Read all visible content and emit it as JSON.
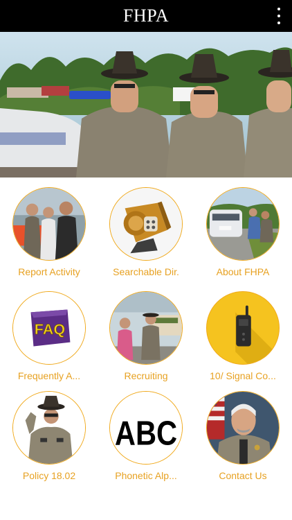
{
  "app": {
    "title": "FHPA",
    "menu_icon": "more-vert-icon"
  },
  "hero": {
    "image": "troopers-banner-photo"
  },
  "colors": {
    "appbar_bg": "#000000",
    "accent": "#e7a121",
    "tile_border": "#f0a818"
  },
  "menu": {
    "items": [
      {
        "label": "Report Activity",
        "icon": "officers-at-event-photo"
      },
      {
        "label": "Searchable Dir.",
        "icon": "directory-device-icon"
      },
      {
        "label": "About FHPA",
        "icon": "traffic-stop-photo"
      },
      {
        "label": "Frequently A...",
        "icon": "faq-icon"
      },
      {
        "label": "Recruiting",
        "icon": "recruiting-booth-photo"
      },
      {
        "label": "10/ Signal Co...",
        "icon": "radio-icon"
      },
      {
        "label": "Policy 18.02",
        "icon": "saluting-trooper-photo"
      },
      {
        "label": "Phonetic Alp...",
        "icon": "abc-icon"
      },
      {
        "label": "Contact Us",
        "icon": "officer-portrait-photo"
      }
    ]
  }
}
